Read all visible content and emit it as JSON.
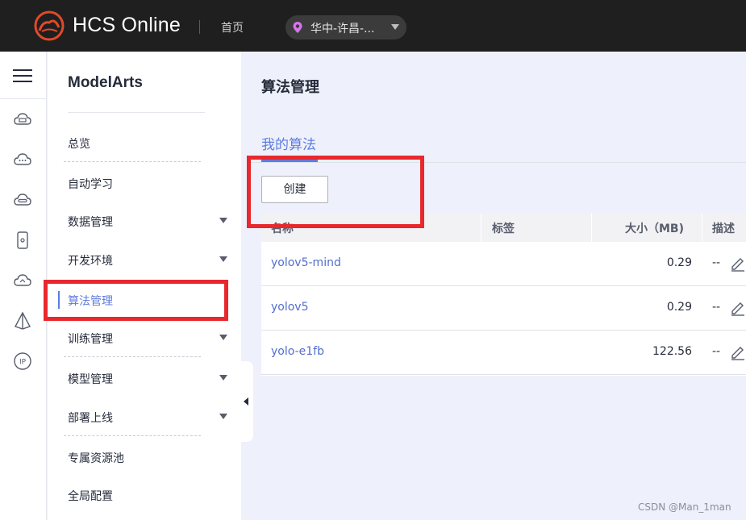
{
  "topbar": {
    "brand": "HCS Online",
    "home": "首页",
    "region": "华中-许昌-..."
  },
  "nav": {
    "title": "ModelArts",
    "items": [
      {
        "label": "总览",
        "expandable": false
      },
      {
        "label": "自动学习",
        "expandable": false
      },
      {
        "label": "数据管理",
        "expandable": true
      },
      {
        "label": "开发环境",
        "expandable": true
      },
      {
        "label": "算法管理",
        "expandable": false,
        "active": true
      },
      {
        "label": "训练管理",
        "expandable": true
      },
      {
        "label": "模型管理",
        "expandable": true
      },
      {
        "label": "部署上线",
        "expandable": true
      },
      {
        "label": "专属资源池",
        "expandable": false
      },
      {
        "label": "全局配置",
        "expandable": false
      }
    ]
  },
  "main": {
    "title": "算法管理",
    "tab": "我的算法",
    "create_label": "创建",
    "table": {
      "columns": [
        "名称",
        "标签",
        "大小（MB)",
        "描述"
      ],
      "rows": [
        {
          "name": "yolov5-mind",
          "size": "0.29",
          "desc": "--"
        },
        {
          "name": "yolov5",
          "size": "0.29",
          "desc": "--"
        },
        {
          "name": "yolo-e1fb",
          "size": "122.56",
          "desc": "--"
        }
      ]
    }
  },
  "colors": {
    "accent": "#5e7ce0",
    "link": "#526ecc",
    "annotation": "#e8282d",
    "topbar": "#1f1f1f"
  },
  "icons": [
    "logo-icon",
    "location-pin-icon",
    "menu-icon",
    "cloud-server-icon",
    "cloud-icon",
    "cloud-disk-icon",
    "phone-icon",
    "cloud-backup-icon",
    "modelarts-icon",
    "ip-icon",
    "edit-icon"
  ],
  "watermark": "CSDN @Man_1man"
}
